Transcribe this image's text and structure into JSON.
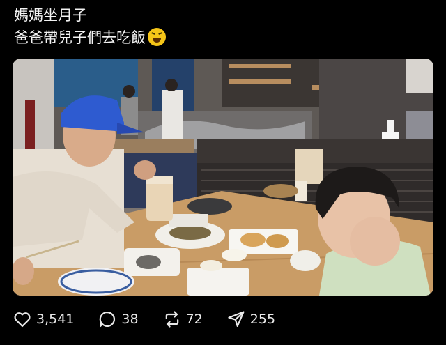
{
  "post": {
    "line1": "媽媽坐月子",
    "line2": "爸爸帶兒子們去吃飯",
    "emoji": "grinning-squinting-face-emoji"
  },
  "photo": {
    "description_icon": "photo-image"
  },
  "actions": {
    "likes": "3,541",
    "replies": "38",
    "reposts": "72",
    "shares": "255"
  },
  "icons": {
    "like": "heart-icon",
    "reply": "comment-bubble-icon",
    "repost": "repost-arrows-icon",
    "share": "send-plane-icon"
  }
}
